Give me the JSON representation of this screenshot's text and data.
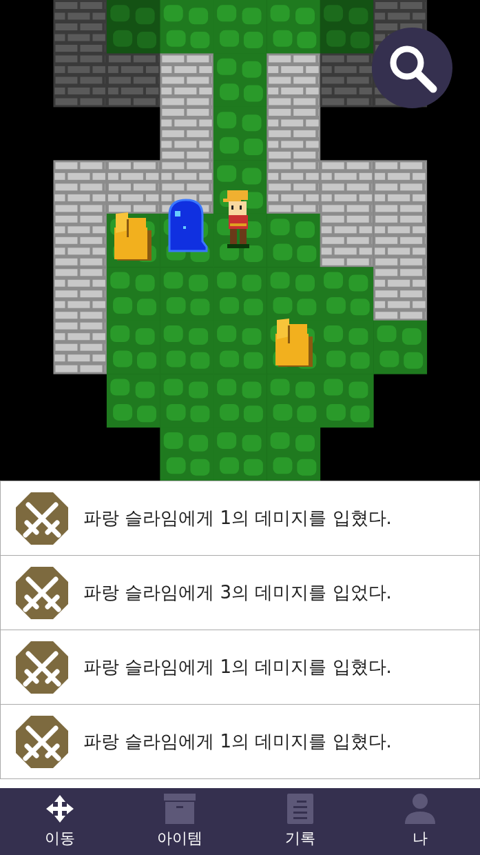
{
  "log": [
    {
      "text": "파랑 슬라임에게 1의 데미지를 입혔다."
    },
    {
      "text": "파랑 슬라임에게 3의 데미지를 입었다."
    },
    {
      "text": "파랑 슬라임에게 1의 데미지를 입혔다."
    },
    {
      "text": "파랑 슬라임에게 1의 데미지를 입혔다."
    }
  ],
  "nav": [
    {
      "kind": "move",
      "label": "이동",
      "selected": true
    },
    {
      "kind": "item",
      "label": "아이템",
      "selected": false
    },
    {
      "kind": "record",
      "label": "기록",
      "selected": false
    },
    {
      "kind": "me",
      "label": "나",
      "selected": false
    }
  ]
}
